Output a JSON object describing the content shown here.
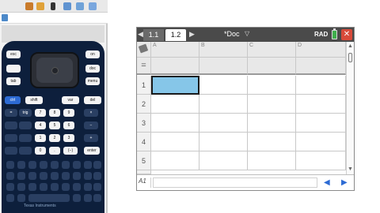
{
  "emulator": {
    "doc_label": "",
    "keys": {
      "esc": "esc",
      "on": "on",
      "doc": "doc",
      "tab": "tab",
      "menu": "menu",
      "ctrl": "ctrl",
      "shift": "shift",
      "var": "var",
      "del": "del",
      "equals": "=",
      "trig": "trig",
      "row7": [
        "7",
        "8",
        "9",
        "×"
      ],
      "row4": [
        "4",
        "5",
        "6",
        "−"
      ],
      "row1": [
        "1",
        "2",
        "3",
        "+"
      ],
      "row0": [
        "0",
        ".",
        "(−)",
        "enter"
      ]
    },
    "brand": "Texas Instruments"
  },
  "app": {
    "tabs": [
      {
        "label": "1.1"
      },
      {
        "label": "1.2"
      }
    ],
    "doc_title": "*Doc",
    "angle_mode": "RAD",
    "columns": [
      "A",
      "B",
      "C",
      "D"
    ],
    "formula_row_symbol": "=",
    "rows": [
      "1",
      "2",
      "3",
      "4",
      "5"
    ],
    "selected_cell": "A1",
    "status_cell_ref": "A1",
    "entry_value": ""
  },
  "colors": {
    "calc_body": "#0d1f3c",
    "selected_cell": "#86c6e8",
    "titlebar": "#4a4a4a",
    "close": "#d84a3a",
    "battery": "#3fae4c",
    "nav_arrows": "#2d6bd4"
  },
  "icons": [
    "tag-icon",
    "battery-icon",
    "close-icon",
    "chevron-down-icon",
    "arrow-left-icon",
    "arrow-right-icon",
    "doc-icon"
  ]
}
